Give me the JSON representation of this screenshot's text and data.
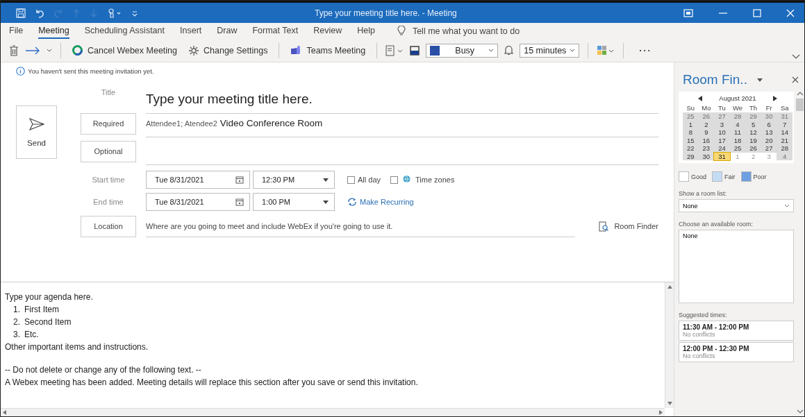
{
  "window": {
    "title": "Type your meeting title here.  -  Meeting"
  },
  "menu_tabs": [
    {
      "label": "File",
      "selected": false
    },
    {
      "label": "Meeting",
      "selected": true
    },
    {
      "label": "Scheduling Assistant",
      "selected": false
    },
    {
      "label": "Insert",
      "selected": false
    },
    {
      "label": "Draw",
      "selected": false
    },
    {
      "label": "Format Text",
      "selected": false
    },
    {
      "label": "Review",
      "selected": false
    },
    {
      "label": "Help",
      "selected": false
    }
  ],
  "tell_me": {
    "placeholder": "Tell me what you want to do"
  },
  "toolbar": {
    "cancel_webex": "Cancel Webex Meeting",
    "change_settings": "Change Settings",
    "teams_meeting": "Teams Meeting",
    "show_as": "Busy",
    "reminder": "15 minutes",
    "more": "···"
  },
  "info_bar": "You haven't sent this meeting invitation yet.",
  "form": {
    "send": "Send",
    "title_label": "Title",
    "title_value": "Type your meeting title here.",
    "required_button": "Required",
    "required_value": "Attendee1; Atendee2",
    "room_value": "Video Conference Room",
    "optional_button": "Optional",
    "start_label": "Start time",
    "start_date": "Tue 8/31/2021",
    "start_time": "12:30 PM",
    "end_label": "End time",
    "end_date": "Tue 8/31/2021",
    "end_time": "1:00 PM",
    "all_day": {
      "label": "All day",
      "checked": false
    },
    "time_zones": {
      "label": "Time zones",
      "checked": false
    },
    "make_recurring": "Make Recurring",
    "location_button": "Location",
    "location_placeholder": "Where are you going to meet and include WebEx if you're going to use it.",
    "room_finder": "Room Finder"
  },
  "body": {
    "intro": "Type your agenda here.",
    "items": [
      {
        "number": "1.",
        "text": "First Item"
      },
      {
        "number": "2.",
        "text": "Second Item"
      },
      {
        "number": "3.",
        "text": "Etc."
      }
    ],
    "other": "Other important items and instructions.",
    "notice": "-- Do not delete or change any of the following text. --",
    "webex": "A Webex meeting has been added. Meeting details will replace this section after you save or send this invitation."
  },
  "room_finder": {
    "title": "Room Fin..",
    "month": "August 2021",
    "weekdays": [
      "Su",
      "Mo",
      "Tu",
      "We",
      "Th",
      "Fr",
      "Sa"
    ],
    "weeks": [
      [
        {
          "label": "25",
          "other_month": true,
          "shaded": true,
          "selected": false
        },
        {
          "label": "26",
          "other_month": true,
          "shaded": true,
          "selected": false
        },
        {
          "label": "27",
          "other_month": true,
          "shaded": true,
          "selected": false
        },
        {
          "label": "28",
          "other_month": true,
          "shaded": true,
          "selected": false
        },
        {
          "label": "29",
          "other_month": true,
          "shaded": true,
          "selected": false
        },
        {
          "label": "30",
          "other_month": true,
          "shaded": true,
          "selected": false
        },
        {
          "label": "31",
          "other_month": true,
          "shaded": true,
          "selected": false
        }
      ],
      [
        {
          "label": "1",
          "other_month": false,
          "shaded": true,
          "selected": false
        },
        {
          "label": "2",
          "other_month": false,
          "shaded": true,
          "selected": false
        },
        {
          "label": "3",
          "other_month": false,
          "shaded": true,
          "selected": false
        },
        {
          "label": "4",
          "other_month": false,
          "shaded": true,
          "selected": false
        },
        {
          "label": "5",
          "other_month": false,
          "shaded": true,
          "selected": false
        },
        {
          "label": "6",
          "other_month": false,
          "shaded": true,
          "selected": false
        },
        {
          "label": "7",
          "other_month": false,
          "shaded": true,
          "selected": false
        }
      ],
      [
        {
          "label": "8",
          "other_month": false,
          "shaded": true,
          "selected": false
        },
        {
          "label": "9",
          "other_month": false,
          "shaded": true,
          "selected": false
        },
        {
          "label": "10",
          "other_month": false,
          "shaded": true,
          "selected": false
        },
        {
          "label": "11",
          "other_month": false,
          "shaded": true,
          "selected": false
        },
        {
          "label": "12",
          "other_month": false,
          "shaded": true,
          "selected": false
        },
        {
          "label": "13",
          "other_month": false,
          "shaded": true,
          "selected": false
        },
        {
          "label": "14",
          "other_month": false,
          "shaded": true,
          "selected": false
        }
      ],
      [
        {
          "label": "15",
          "other_month": false,
          "shaded": true,
          "selected": false
        },
        {
          "label": "16",
          "other_month": false,
          "shaded": true,
          "selected": false
        },
        {
          "label": "17",
          "other_month": false,
          "shaded": true,
          "selected": false
        },
        {
          "label": "18",
          "other_month": false,
          "shaded": true,
          "selected": false
        },
        {
          "label": "19",
          "other_month": false,
          "shaded": true,
          "selected": false
        },
        {
          "label": "20",
          "other_month": false,
          "shaded": true,
          "selected": false
        },
        {
          "label": "21",
          "other_month": false,
          "shaded": true,
          "selected": false
        }
      ],
      [
        {
          "label": "22",
          "other_month": false,
          "shaded": true,
          "selected": false
        },
        {
          "label": "23",
          "other_month": false,
          "shaded": true,
          "selected": false
        },
        {
          "label": "24",
          "other_month": false,
          "shaded": true,
          "selected": false
        },
        {
          "label": "25",
          "other_month": false,
          "shaded": true,
          "selected": false
        },
        {
          "label": "26",
          "other_month": false,
          "shaded": true,
          "selected": false
        },
        {
          "label": "27",
          "other_month": false,
          "shaded": true,
          "selected": false
        },
        {
          "label": "28",
          "other_month": false,
          "shaded": true,
          "selected": false
        }
      ],
      [
        {
          "label": "29",
          "other_month": false,
          "shaded": true,
          "selected": false
        },
        {
          "label": "30",
          "other_month": false,
          "shaded": true,
          "selected": false
        },
        {
          "label": "31",
          "other_month": false,
          "shaded": true,
          "selected": true
        },
        {
          "label": "1",
          "other_month": true,
          "shaded": false,
          "selected": false
        },
        {
          "label": "2",
          "other_month": true,
          "shaded": false,
          "selected": false
        },
        {
          "label": "3",
          "other_month": true,
          "shaded": false,
          "selected": false
        },
        {
          "label": "4",
          "other_month": true,
          "shaded": true,
          "selected": false
        }
      ]
    ],
    "legend": [
      {
        "label": "Good",
        "color": "#ffffff"
      },
      {
        "label": "Fair",
        "color": "#c5dcf5"
      },
      {
        "label": "Poor",
        "color": "#6e9fe0"
      }
    ],
    "room_list_label": "Show a room list:",
    "room_list_value": "None",
    "available_label": "Choose an available room:",
    "available_rooms": [
      "None"
    ],
    "suggested_label": "Suggested times:",
    "suggested": [
      {
        "time": "11:30 AM - 12:00 PM",
        "status": "No conflicts"
      },
      {
        "time": "12:00 PM - 12:30 PM",
        "status": "No conflicts"
      }
    ]
  }
}
